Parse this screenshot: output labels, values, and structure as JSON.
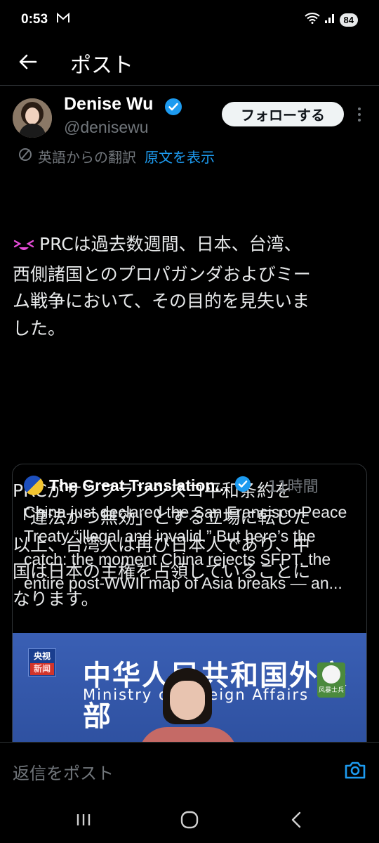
{
  "status_bar": {
    "time": "0:53",
    "battery": "84"
  },
  "header": {
    "title": "ポスト"
  },
  "author": {
    "name": "Denise Wu",
    "handle": "@denisewu",
    "follow_label": "フォローする"
  },
  "translation": {
    "label": "英語からの翻訳",
    "show_original": "原文を表示"
  },
  "tweet": {
    "paragraph1": "PRCは過去数週間、日本、台湾、\n西側諸国とのプロパガンダおよびミー\nム戦争において、その目的を見失いま\nした。",
    "paragraph2": "PRCがサンフランシスコ平和条約を\n「違法かつ無効」とする立場に転じた\n以上、台湾人は再び日本人であり、中\n国は日本の主権を占領していることに\nなります。"
  },
  "quote": {
    "name": "The Great Translation...",
    "time": "· 11時間",
    "text": "China just declared the San Francisco Peace Treaty “illegal and invalid.” But here’s the catch: the moment China rejects SFPT, the entire post-WWII map of Asia breaks — an...",
    "media": {
      "logo_line1": "央视",
      "logo_line2": "新闻",
      "headline_cn": "中华人民共和国外交部",
      "headline_en": "Ministry of Foreign Affairs",
      "stamp": "风暴士兵"
    }
  },
  "reply": {
    "placeholder": "返信をポスト"
  },
  "colors": {
    "accent": "#1d9bf0",
    "background": "#000000",
    "muted": "#71767b"
  }
}
